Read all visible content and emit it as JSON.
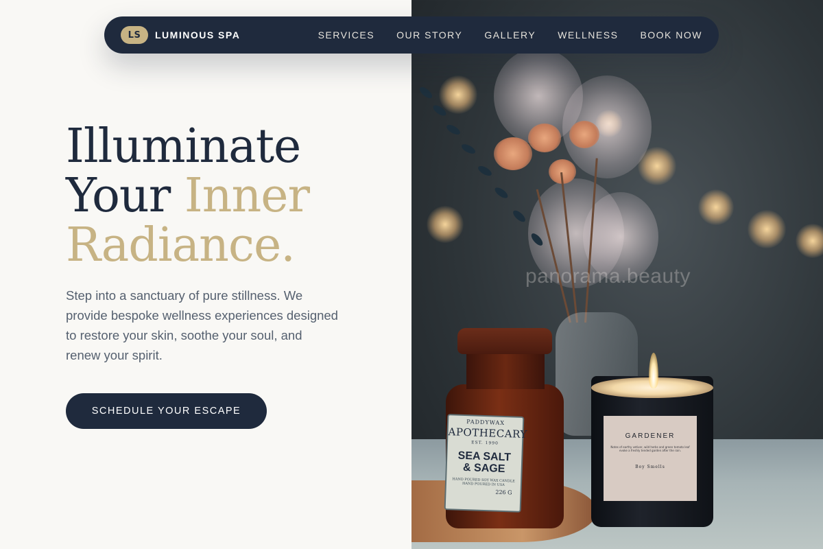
{
  "brand": {
    "badge": "LS",
    "name": "LUMINOUS SPA"
  },
  "nav": {
    "items": [
      {
        "label": "SERVICES"
      },
      {
        "label": "OUR STORY"
      },
      {
        "label": "GALLERY"
      },
      {
        "label": "WELLNESS"
      },
      {
        "label": "BOOK NOW"
      }
    ]
  },
  "hero": {
    "title_line1": "Illuminate",
    "title_line2_a": "Your ",
    "title_line2_b": "Inner",
    "title_line3": "Radiance.",
    "subtitle": "Step into a sanctuary of pure stillness. We provide bespoke wellness experiences designed to restore your skin, soothe your soul, and renew your spirit.",
    "cta_label": "SCHEDULE YOUR ESCAPE"
  },
  "photo": {
    "watermark": "panorama.beauty",
    "jar_label": {
      "brand": "PADDYWAX",
      "title": "APOTHECARY",
      "est": "EST. 1990",
      "scent_line1": "SEA SALT",
      "scent_line2": "& SAGE",
      "fine": "HAND POURED SOY WAX CANDLE HAND POURED IN USA",
      "weight": "226 G"
    },
    "candle_label": {
      "name": "GARDENER",
      "fine": "Notes of earthy vetiver, wild herbs and green tomato leaf evoke a freshly tended garden after the rain.",
      "maker": "Boy Smells"
    }
  },
  "colors": {
    "navy": "#1f2a3d",
    "gold": "#c7b384",
    "background": "#f9f8f5",
    "body_text": "#55606f"
  }
}
